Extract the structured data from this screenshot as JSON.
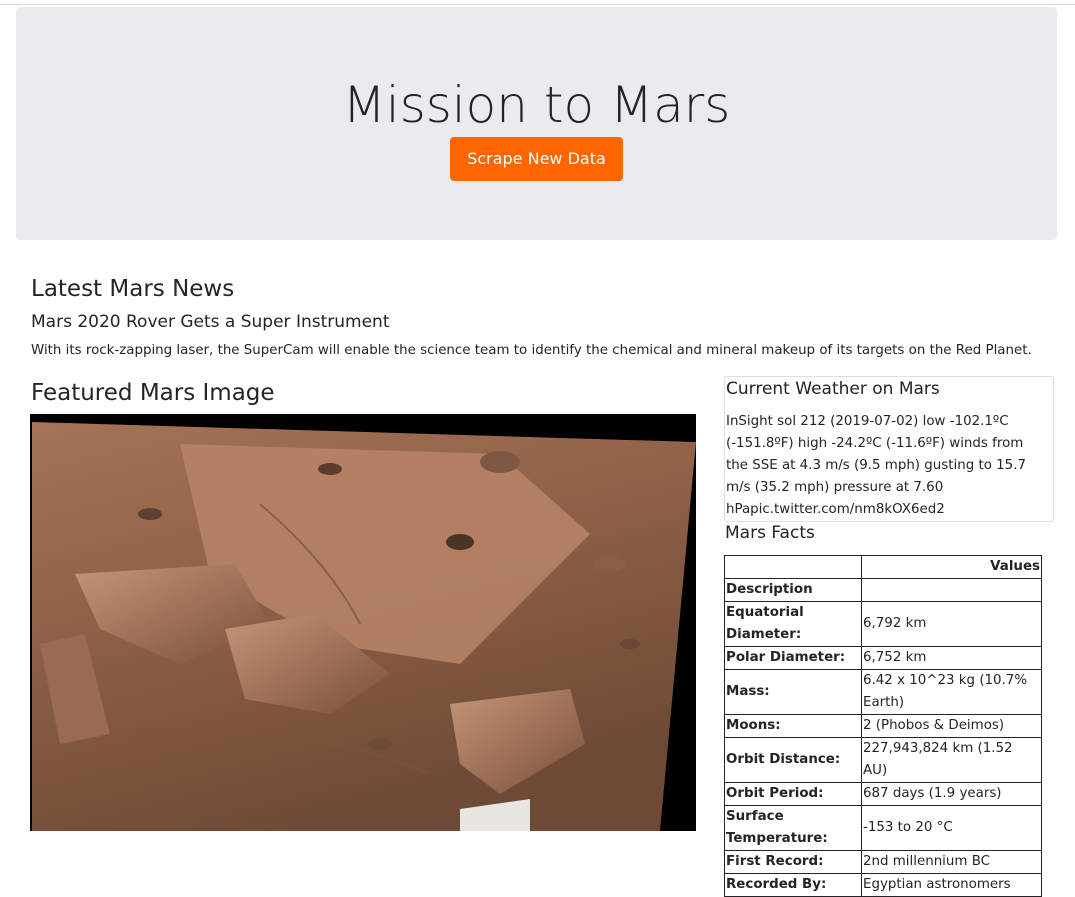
{
  "header": {
    "title": "Mission to Mars",
    "scrape_button": "Scrape New Data"
  },
  "news": {
    "section_heading": "Latest Mars News",
    "title": "Mars 2020 Rover Gets a Super Instrument",
    "paragraph": "With its rock-zapping laser, the SuperCam will enable the science team to identify the chemical and mineral makeup of its targets on the Red Planet."
  },
  "featured": {
    "heading": "Featured Mars Image"
  },
  "weather": {
    "heading": "Current Weather on Mars",
    "text": "InSight sol 212 (2019-07-02) low -102.1ºC (-151.8ºF) high -24.2ºC (-11.6ºF) winds from the SSE at 4.3 m/s (9.5 mph) gusting to 15.7 m/s (35.2 mph) pressure at 7.60 hPapic.twitter.com/nm8kOX6ed2"
  },
  "facts": {
    "heading": "Mars Facts",
    "column_header": "Values",
    "index_label": "Description",
    "rows": [
      {
        "label": "Equatorial Diameter:",
        "value": "6,792 km"
      },
      {
        "label": "Polar Diameter:",
        "value": "6,752 km"
      },
      {
        "label": "Mass:",
        "value": "6.42 x 10^23 kg (10.7% Earth)"
      },
      {
        "label": "Moons:",
        "value": "2 (Phobos & Deimos)"
      },
      {
        "label": "Orbit Distance:",
        "value": "227,943,824 km (1.52 AU)"
      },
      {
        "label": "Orbit Period:",
        "value": "687 days (1.9 years)"
      },
      {
        "label": "Surface Temperature:",
        "value": "-153 to 20 °C"
      },
      {
        "label": "First Record:",
        "value": "2nd millennium BC"
      },
      {
        "label": "Recorded By:",
        "value": "Egyptian astronomers"
      }
    ]
  },
  "colors": {
    "button": "#ff6600",
    "jumbotron": "#e9ecef",
    "text": "#212529"
  }
}
